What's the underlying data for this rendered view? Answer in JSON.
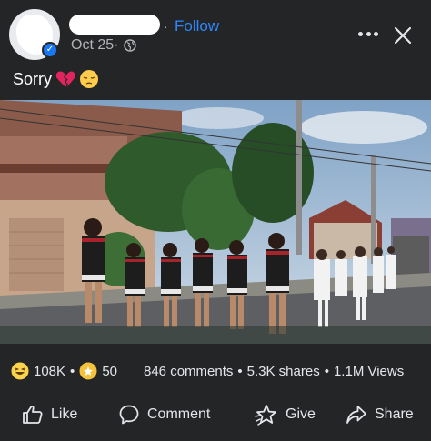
{
  "post": {
    "follow_label": "Follow",
    "separator": "·",
    "date": "Oct 25",
    "date_suffix": " ·",
    "caption_text": "Sorry",
    "caption_emojis": [
      "broken-heart",
      "pensive-face"
    ]
  },
  "engagement": {
    "reactions": [
      {
        "icon": "haha-icon",
        "count": "108K"
      },
      {
        "icon": "care-icon",
        "count": "50"
      }
    ],
    "comments": "846 comments",
    "shares": "5.3K shares",
    "views": "1.1M Views",
    "bullet": "•"
  },
  "actions": [
    {
      "label": "Like",
      "icon": "thumbs-up-icon"
    },
    {
      "label": "Comment",
      "icon": "comment-bubble-icon"
    },
    {
      "label": "Give",
      "icon": "star-icon"
    },
    {
      "label": "Share",
      "icon": "share-arrow-icon"
    }
  ],
  "colors": {
    "background": "#242526",
    "link": "#2d88ff",
    "text": "#e4e6eb",
    "muted": "#b0b3b8",
    "verified": "#1877f2"
  }
}
